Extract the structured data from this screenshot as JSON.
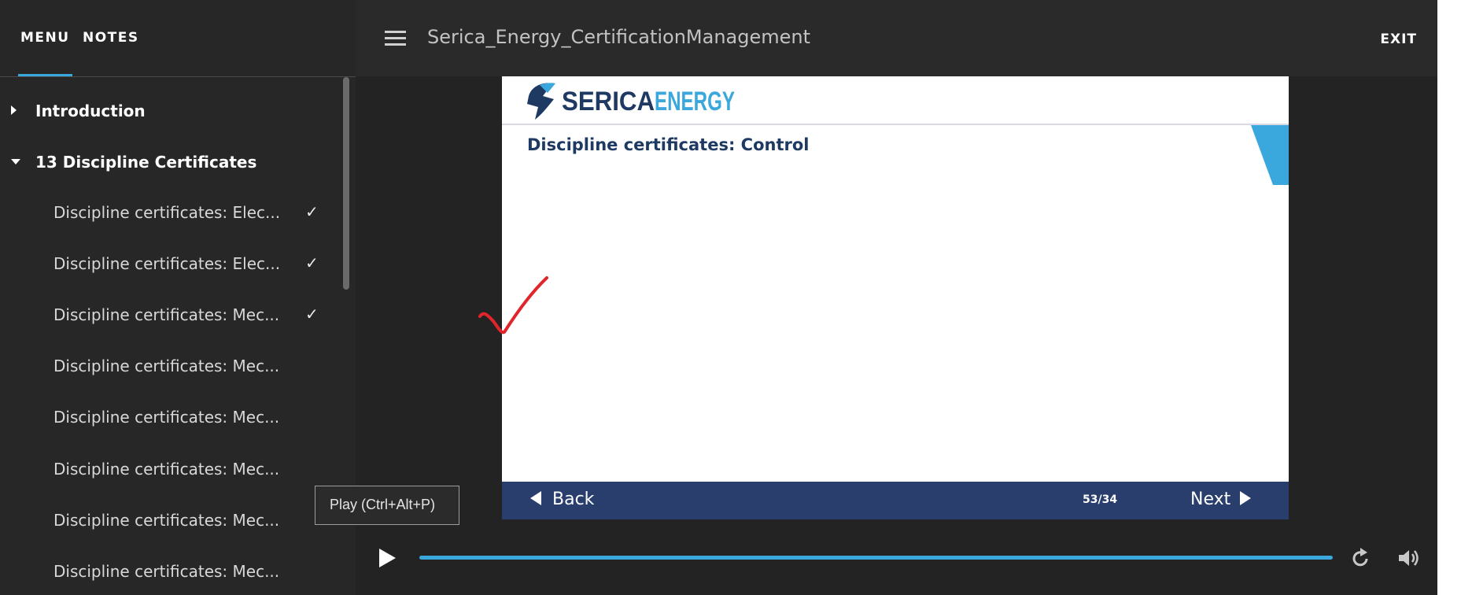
{
  "sidebar": {
    "tabs": [
      "MENU",
      "NOTES"
    ],
    "sections": [
      {
        "label": "Introduction",
        "expanded": false
      },
      {
        "label": "13 Discipline Certificates",
        "expanded": true
      }
    ],
    "items": [
      {
        "label": "Discipline certificates: Elec...",
        "completed": true
      },
      {
        "label": "Discipline certificates: Elec...",
        "completed": true
      },
      {
        "label": "Discipline certificates: Mec...",
        "completed": true
      },
      {
        "label": "Discipline certificates: Mec...",
        "completed": false
      },
      {
        "label": "Discipline certificates: Mec...",
        "completed": false
      },
      {
        "label": "Discipline certificates: Mec...",
        "completed": false
      },
      {
        "label": "Discipline certificates: Mec...",
        "completed": false
      },
      {
        "label": "Discipline certificates: Mec...",
        "completed": false
      }
    ],
    "check_glyph": "✓"
  },
  "header": {
    "title": "Serica_Energy_CertificationManagement",
    "exit_label": "EXIT"
  },
  "slide": {
    "logo": {
      "part1": "SERICA",
      "part2": "ENERGY"
    },
    "title": "Discipline certificates: Control",
    "nav": {
      "back_label": "Back",
      "next_label": "Next",
      "page_count": "53/34"
    }
  },
  "player": {
    "tooltip": "Play (Ctrl+Alt+P)",
    "progress": 1.0
  },
  "colors": {
    "accent": "#3aa7dd",
    "navy": "#2a3e6e",
    "title_navy": "#1e3a63",
    "logo_blue": "#3aa7dd"
  }
}
